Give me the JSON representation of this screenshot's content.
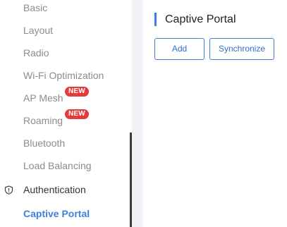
{
  "sidebar": {
    "items": [
      {
        "label": "Basic"
      },
      {
        "label": "Layout"
      },
      {
        "label": "Radio"
      },
      {
        "label": "Wi-Fi Optimization"
      },
      {
        "label": "AP Mesh",
        "badge": "NEW"
      },
      {
        "label": "Roaming",
        "badge": "NEW"
      },
      {
        "label": "Bluetooth"
      },
      {
        "label": "Load Balancing"
      },
      {
        "label": "Authentication",
        "icon": "shield-icon"
      },
      {
        "label": "Captive Portal"
      }
    ]
  },
  "main": {
    "title": "Captive Portal",
    "buttons": {
      "add": "Add",
      "synchronize": "Synchronize"
    }
  },
  "colors": {
    "accent": "#3d7fdb",
    "badge": "#e5393c",
    "muted_text": "#8c8c8c",
    "gutter": "#f0f2f5"
  }
}
